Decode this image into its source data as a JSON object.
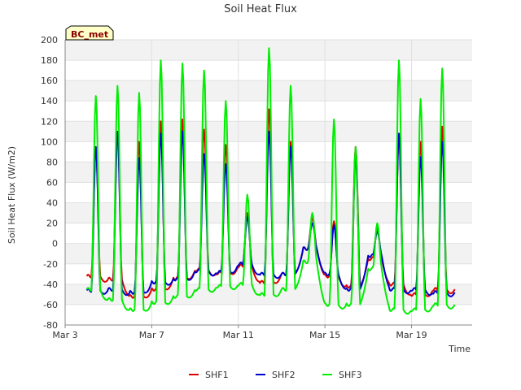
{
  "chart_data": {
    "type": "line",
    "title": "Soil Heat Flux",
    "xlabel": "Time",
    "ylabel": "Soil Heat Flux (W/m2)",
    "badge": "BC_met",
    "ylim": [
      -80,
      200
    ],
    "yticks": [
      -80,
      -60,
      -40,
      -20,
      0,
      20,
      40,
      60,
      80,
      100,
      120,
      140,
      160,
      180,
      200
    ],
    "xlim": [
      0,
      18.8
    ],
    "xticks": [
      {
        "value": 0,
        "label": "Mar 3"
      },
      {
        "value": 4,
        "label": "Mar 7"
      },
      {
        "value": 8,
        "label": "Mar 11"
      },
      {
        "value": 12,
        "label": "Mar 15"
      },
      {
        "value": 16,
        "label": "Mar 19"
      }
    ],
    "grid": true,
    "legend_position": "bottom-center",
    "series": [
      {
        "name": "SHF1",
        "color": "#dd0000",
        "daily_peaks": [
          95,
          110,
          100,
          120,
          122,
          112,
          97,
          30,
          132,
          100,
          25,
          22,
          95,
          15,
          108,
          100,
          115
        ],
        "daily_mins": [
          -32,
          -35,
          -52,
          -45,
          -34,
          -26,
          -29,
          -22,
          -38,
          -30,
          -5,
          -32,
          -42,
          -15,
          -40,
          -50,
          -45
        ]
      },
      {
        "name": "SHF2",
        "color": "#0000cc",
        "daily_peaks": [
          95,
          110,
          84,
          108,
          110,
          88,
          78,
          26,
          110,
          95,
          20,
          18,
          85,
          12,
          108,
          85,
          100
        ],
        "daily_mins": [
          -46,
          -45,
          -48,
          -38,
          -35,
          -27,
          -28,
          -20,
          -30,
          -30,
          -5,
          -30,
          -45,
          -12,
          -45,
          -45,
          -48
        ]
      },
      {
        "name": "SHF3",
        "color": "#00ee00",
        "daily_peaks": [
          145,
          155,
          148,
          180,
          177,
          170,
          140,
          48,
          192,
          155,
          30,
          122,
          95,
          20,
          180,
          142,
          172
        ],
        "daily_mins": [
          -45,
          -55,
          -65,
          -58,
          -52,
          -45,
          -42,
          -40,
          -50,
          -45,
          -18,
          -60,
          -60,
          -25,
          -65,
          -65,
          -60
        ]
      }
    ]
  }
}
